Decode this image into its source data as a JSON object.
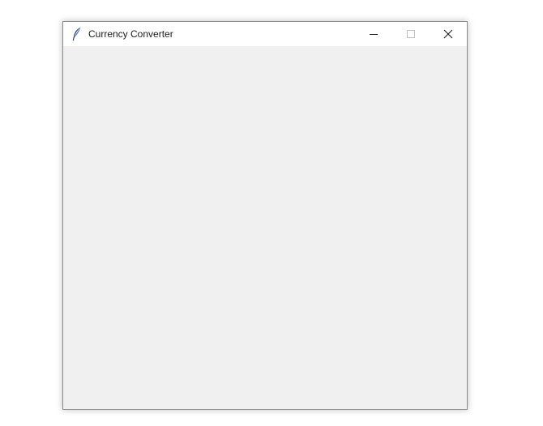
{
  "window": {
    "title": "Currency Converter",
    "app_icon": "feather-icon",
    "controls": {
      "minimize_icon": "minimize-icon",
      "maximize_icon": "maximize-icon",
      "close_icon": "close-icon"
    }
  },
  "colors": {
    "titlebar_bg": "#ffffff",
    "client_bg": "#f0f0f0",
    "border": "#8a8a8a",
    "title_text": "#1a1a1a",
    "icon_accent": "#1f3a7a"
  }
}
